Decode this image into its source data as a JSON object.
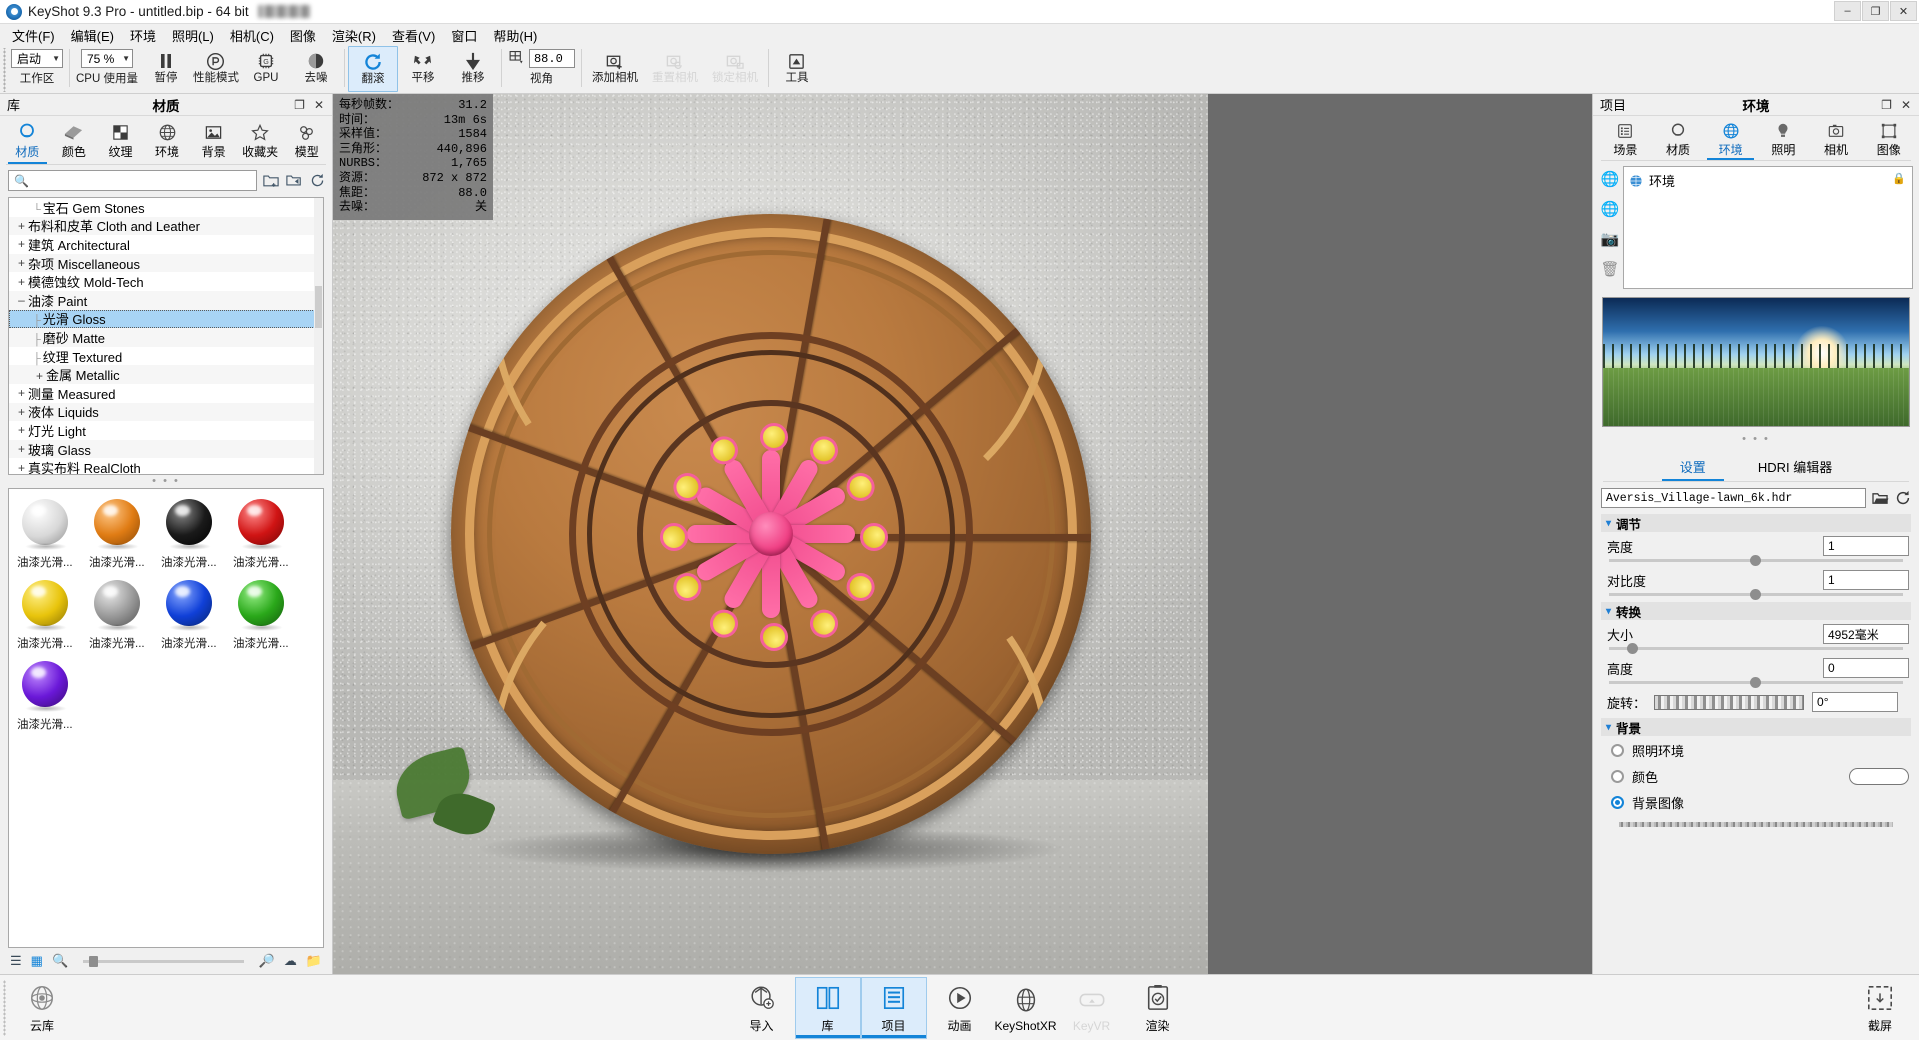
{
  "window": {
    "title": "KeyShot 9.3 Pro  - untitled.bip  - 64 bit",
    "minimize": "–",
    "maximize": "❐",
    "close": "✕"
  },
  "menubar": {
    "items": [
      {
        "label": "文件(F)"
      },
      {
        "label": "编辑(E)"
      },
      {
        "label": "环境"
      },
      {
        "label": "照明(L)"
      },
      {
        "label": "相机(C)"
      },
      {
        "label": "图像"
      },
      {
        "label": "渲染(R)"
      },
      {
        "label": "查看(V)"
      },
      {
        "label": "窗口"
      },
      {
        "label": "帮助(H)"
      }
    ]
  },
  "toolbar": {
    "workspace": {
      "value": "启动",
      "caption": "工作区"
    },
    "cpu": {
      "value": "75 %",
      "caption": "CPU 使用量"
    },
    "pause": {
      "caption": "暂停",
      "icon": "pause-icon"
    },
    "performance": {
      "caption": "性能模式",
      "icon": "performance-icon"
    },
    "gpu": {
      "caption": "GPU",
      "icon": "gpu-chip-icon"
    },
    "denoise": {
      "caption": "去噪",
      "icon": "denoise-icon"
    },
    "tumble": {
      "caption": "翻滚",
      "icon": "tumble-icon",
      "active": true
    },
    "pan": {
      "caption": "平移",
      "icon": "pan-icon"
    },
    "dolly": {
      "caption": "推移",
      "icon": "dolly-icon"
    },
    "fov": {
      "value": "88.0",
      "caption": "视角",
      "icon": "grid-perspective-icon"
    },
    "add_camera": {
      "caption": "添加相机",
      "icon": "camera-add-icon"
    },
    "reset_camera": {
      "caption": "重置相机",
      "icon": "camera-reset-icon",
      "disabled": true
    },
    "lock_camera": {
      "caption": "锁定相机",
      "icon": "camera-lock-icon",
      "disabled": true
    },
    "tools": {
      "caption": "工具",
      "icon": "tools-icon"
    }
  },
  "library": {
    "panel_left_title": "库",
    "panel_center_title": "材质",
    "restore_icon": "❐",
    "close_icon": "✕",
    "tabs": [
      {
        "label": "材质",
        "icon": "material-sphere-icon",
        "selected": true
      },
      {
        "label": "颜色",
        "icon": "color-swatch-icon",
        "selected": false
      },
      {
        "label": "纹理",
        "icon": "texture-checker-icon",
        "selected": false
      },
      {
        "label": "环境",
        "icon": "environment-globe-icon",
        "selected": false
      },
      {
        "label": "背景",
        "icon": "backplate-image-icon",
        "selected": false
      },
      {
        "label": "收藏夹",
        "icon": "star-icon",
        "selected": false
      },
      {
        "label": "模型",
        "icon": "model-cubes-icon",
        "selected": false
      }
    ],
    "search": {
      "value": "",
      "placeholder": "",
      "icon": "search-icon"
    },
    "search_buttons": [
      {
        "icon": "folder-add-icon"
      },
      {
        "icon": "folder-open-icon"
      },
      {
        "icon": "refresh-icon"
      }
    ],
    "tree": [
      {
        "label": "宝石 Gem Stones",
        "toggle": "",
        "depth": 1,
        "selected": false
      },
      {
        "label": "布料和皮革 Cloth and Leather",
        "toggle": "+",
        "depth": 0,
        "selected": false
      },
      {
        "label": "建筑 Architectural",
        "toggle": "+",
        "depth": 0,
        "selected": false
      },
      {
        "label": "杂项 Miscellaneous",
        "toggle": "+",
        "depth": 0,
        "selected": false
      },
      {
        "label": "模德蚀纹 Mold-Tech",
        "toggle": "+",
        "depth": 0,
        "selected": false
      },
      {
        "label": "油漆 Paint",
        "toggle": "–",
        "depth": 0,
        "selected": false
      },
      {
        "label": "光滑 Gloss",
        "toggle": "",
        "depth": 1,
        "selected": true
      },
      {
        "label": "磨砂 Matte",
        "toggle": "",
        "depth": 1,
        "selected": false
      },
      {
        "label": "纹理 Textured",
        "toggle": "",
        "depth": 1,
        "selected": false
      },
      {
        "label": "金属 Metallic",
        "toggle": "+",
        "depth": 1,
        "selected": false
      },
      {
        "label": "测量 Measured",
        "toggle": "+",
        "depth": 0,
        "selected": false
      },
      {
        "label": "液体 Liquids",
        "toggle": "+",
        "depth": 0,
        "selected": false
      },
      {
        "label": "灯光 Light",
        "toggle": "+",
        "depth": 0,
        "selected": false
      },
      {
        "label": "玻璃 Glass",
        "toggle": "+",
        "depth": 0,
        "selected": false
      },
      {
        "label": "真实布料 RealCloth",
        "toggle": "+",
        "depth": 0,
        "selected": false
      }
    ],
    "dots": "• • •",
    "swatches": [
      {
        "label": "油漆光滑...",
        "color": "#d8d8d8",
        "hi": "#ffffff"
      },
      {
        "label": "油漆光滑...",
        "color": "#e07c14",
        "hi": "#ffc98a"
      },
      {
        "label": "油漆光滑...",
        "color": "#1a1a1a",
        "hi": "#8a8a8a"
      },
      {
        "label": "油漆光滑...",
        "color": "#d01414",
        "hi": "#ff8c8c"
      },
      {
        "label": "油漆光滑...",
        "color": "#e8c40c",
        "hi": "#fff08a"
      },
      {
        "label": "油漆光滑...",
        "color": "#9a9a9a",
        "hi": "#e8e8e8"
      },
      {
        "label": "油漆光滑...",
        "color": "#1040d8",
        "hi": "#88a8ff"
      },
      {
        "label": "油漆光滑...",
        "color": "#2aa81a",
        "hi": "#96ee86"
      },
      {
        "label": "油漆光滑...",
        "color": "#6a18d8",
        "hi": "#c08aff"
      }
    ],
    "footer_icons": [
      {
        "icon": "list-view-icon"
      },
      {
        "icon": "grid-view-icon"
      },
      {
        "icon": "zoom-out-icon"
      },
      {
        "icon": "zoom-in-icon"
      },
      {
        "icon": "cloud-download-icon"
      },
      {
        "icon": "folder-icon"
      }
    ]
  },
  "viewport": {
    "stats": [
      {
        "key": "每秒帧数：",
        "value": "31.2"
      },
      {
        "key": "时间：",
        "value": "13m  6s"
      },
      {
        "key": "采样值：",
        "value": "1584"
      },
      {
        "key": "三角形：",
        "value": "440,896"
      },
      {
        "key": "NURBS：",
        "value": "1,765"
      },
      {
        "key": "资源：",
        "value": "872 x 872"
      },
      {
        "key": "焦距：",
        "value": "88.0"
      },
      {
        "key": "去噪：",
        "value": "关"
      }
    ]
  },
  "project": {
    "panel_left_title": "项目",
    "panel_center_title": "环境",
    "restore_icon": "❐",
    "close_icon": "✕",
    "tabs": [
      {
        "label": "场景",
        "icon": "scene-list-icon",
        "selected": false
      },
      {
        "label": "材质",
        "icon": "material-sphere-icon",
        "selected": false
      },
      {
        "label": "环境",
        "icon": "environment-globe-icon",
        "selected": true
      },
      {
        "label": "照明",
        "icon": "lightbulb-icon",
        "selected": false
      },
      {
        "label": "相机",
        "icon": "camera-icon",
        "selected": false
      },
      {
        "label": "图像",
        "icon": "image-frame-icon",
        "selected": false
      }
    ],
    "env_tools": [
      {
        "icon": "globe-dim-icon"
      },
      {
        "icon": "globe-add-icon"
      },
      {
        "icon": "backplate-add-icon"
      },
      {
        "icon": "trash-icon"
      }
    ],
    "env_list": [
      {
        "label": "环境",
        "icon": "environment-globe-icon",
        "lock": "lock-icon"
      }
    ],
    "preview_dots": "• • •",
    "sub_tabs": [
      {
        "label": "设置",
        "selected": true
      },
      {
        "label": "HDRI 编辑器",
        "selected": false
      }
    ],
    "hdri_file": {
      "value": "Aversis_Village-lawn_6k.hdr",
      "open_icon": "folder-open-icon",
      "reload_icon": "refresh-icon"
    },
    "sections": [
      {
        "title": "调节",
        "chevron": "▾",
        "rows": [
          {
            "label": "亮度",
            "value": "1",
            "slider": 50
          },
          {
            "label": "对比度",
            "value": "1",
            "slider": 50
          }
        ]
      },
      {
        "title": "转换",
        "chevron": "▾",
        "rows": [
          {
            "label": "大小",
            "value": "4952毫米",
            "slider": 7
          },
          {
            "label": "高度",
            "value": "0",
            "slider": 50
          }
        ],
        "rotation": {
          "label": "旋转：",
          "value": "0°"
        }
      },
      {
        "title": "背景",
        "chevron": "▾",
        "options": [
          {
            "label": "照明环境",
            "selected": false,
            "color": null
          },
          {
            "label": "颜色",
            "selected": false,
            "color": "#ffffff"
          },
          {
            "label": "背景图像",
            "selected": true,
            "color": null
          }
        ]
      }
    ]
  },
  "bottombar": {
    "cloud": {
      "label": "云库",
      "icon": "cloud-icon"
    },
    "items": [
      {
        "label": "导入",
        "icon": "import-icon",
        "selected": false,
        "dim": false
      },
      {
        "label": "库",
        "icon": "library-book-icon",
        "selected": true,
        "dim": false
      },
      {
        "label": "项目",
        "icon": "project-list-icon",
        "selected": true,
        "dim": false
      },
      {
        "label": "动画",
        "icon": "animation-play-icon",
        "selected": false,
        "dim": false
      },
      {
        "label": "KeyShotXR",
        "icon": "keyshotxr-icon",
        "selected": false,
        "dim": false
      },
      {
        "label": "KeyVR",
        "icon": "keyvr-icon",
        "selected": false,
        "dim": true
      },
      {
        "label": "渲染",
        "icon": "render-icon",
        "selected": false,
        "dim": false
      }
    ],
    "screenshot": {
      "label": "截屏",
      "icon": "screenshot-icon"
    }
  }
}
